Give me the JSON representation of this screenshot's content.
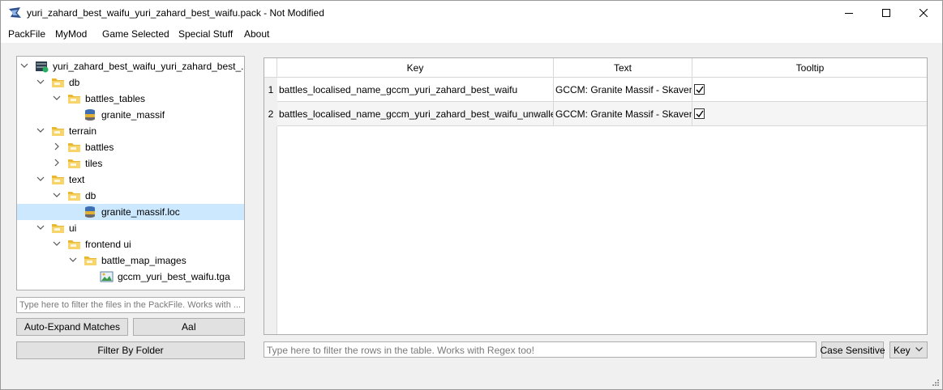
{
  "window": {
    "title": "yuri_zahard_best_waifu_yuri_zahard_best_waifu.pack - Not Modified"
  },
  "menu": [
    "PackFile",
    "MyMod",
    "Game Selected",
    "Special Stuff",
    "About"
  ],
  "tree": {
    "items": [
      {
        "label": "yuri_zahard_best_waifu_yuri_zahard_best_...",
        "type": "pack",
        "level": 0,
        "expanded": true
      },
      {
        "label": "db",
        "type": "folder",
        "level": 1,
        "expanded": true
      },
      {
        "label": "battles_tables",
        "type": "folder",
        "level": 2,
        "expanded": true
      },
      {
        "label": "granite_massif",
        "type": "db",
        "level": 3
      },
      {
        "label": "terrain",
        "type": "folder",
        "level": 1,
        "expanded": true
      },
      {
        "label": "battles",
        "type": "folder",
        "level": 2,
        "expanded": false
      },
      {
        "label": "tiles",
        "type": "folder",
        "level": 2,
        "expanded": false
      },
      {
        "label": "text",
        "type": "folder",
        "level": 1,
        "expanded": true
      },
      {
        "label": "db",
        "type": "folder",
        "level": 2,
        "expanded": true
      },
      {
        "label": "granite_massif.loc",
        "type": "db",
        "level": 3,
        "selected": true
      },
      {
        "label": "ui",
        "type": "folder",
        "level": 1,
        "expanded": true
      },
      {
        "label": "frontend ui",
        "type": "folder",
        "level": 2,
        "expanded": true
      },
      {
        "label": "battle_map_images",
        "type": "folder",
        "level": 3,
        "expanded": true
      },
      {
        "label": "gccm_yuri_best_waifu.tga",
        "type": "image",
        "level": 4
      }
    ]
  },
  "left_panel": {
    "filter_placeholder": "Type here to filter the files in the PackFile. Works with ...",
    "auto_expand_label": "Auto-Expand Matches",
    "case_label": "AaI",
    "filter_by_folder_label": "Filter By Folder"
  },
  "table": {
    "columns": [
      "Key",
      "Text",
      "Tooltip"
    ],
    "rows": [
      {
        "index": "1",
        "key": "battles_localised_name_gccm_yuri_zahard_best_waifu",
        "text": "GCCM: Granite Massif - Skaven",
        "tooltip": true
      },
      {
        "index": "2",
        "key": "battles_localised_name_gccm_yuri_zahard_best_waifu_unwalled",
        "text": "GCCM: Granite Massif - Skaven",
        "tooltip": true
      }
    ]
  },
  "bottom_bar": {
    "filter_placeholder": "Type here to filter the rows in the table. Works with Regex too!",
    "case_sensitive_label": "Case Sensitive",
    "column_select_value": "Key"
  },
  "colors": {
    "selection": "#cce8ff",
    "folder": "#e8b830"
  }
}
